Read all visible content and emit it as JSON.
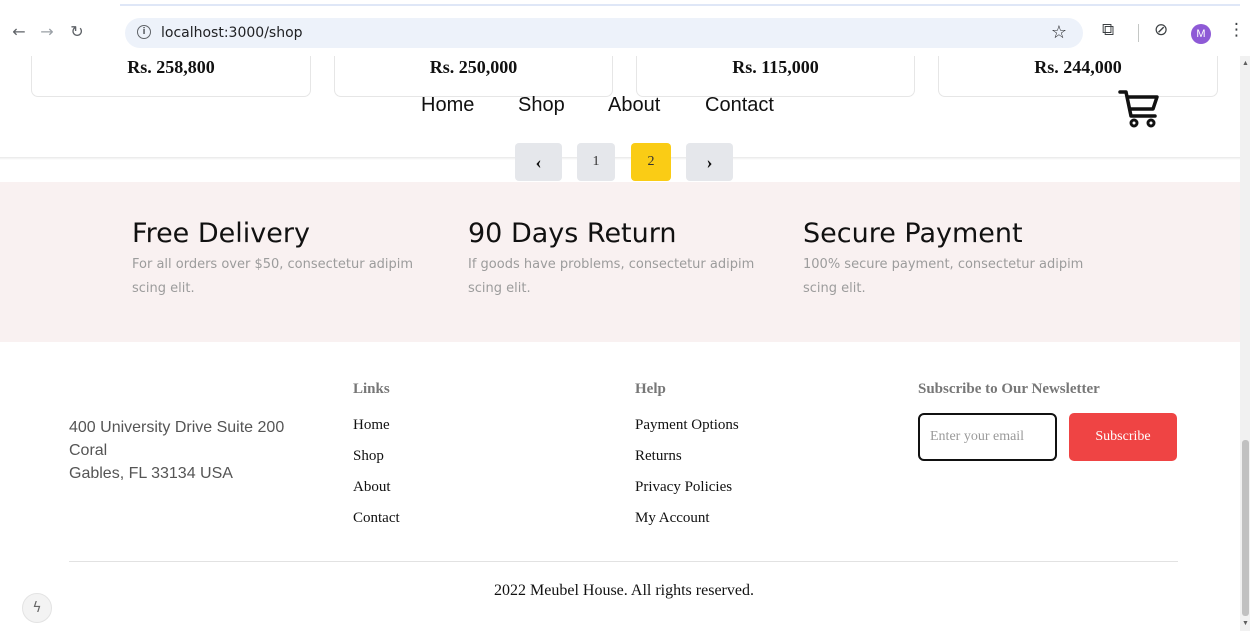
{
  "browser": {
    "url": "localhost:3000/shop",
    "avatar_initial": "M"
  },
  "product_prices": [
    "Rs. 258,800",
    "Rs. 250,000",
    "Rs. 115,000",
    "Rs. 244,000"
  ],
  "nav": {
    "items": [
      "Home",
      "Shop",
      "About",
      "Contact"
    ],
    "cart_icon": "cart-icon"
  },
  "pagination": {
    "prev": "‹",
    "pages": [
      "1",
      "2"
    ],
    "current": "2",
    "next": "›"
  },
  "features": [
    {
      "title": "Free Delivery",
      "desc": "For all orders over $50, consectetur adipim scing elit."
    },
    {
      "title": "90 Days Return",
      "desc": "If goods have problems, consectetur adipim scing elit."
    },
    {
      "title": "Secure Payment",
      "desc": "100% secure payment, consectetur adipim scing elit."
    }
  ],
  "footer": {
    "address_line1": "400 University Drive Suite 200",
    "address_line2": "Coral",
    "address_line3": "Gables, FL 33134 USA",
    "links_heading": "Links",
    "links": [
      "Home",
      "Shop",
      "About",
      "Contact"
    ],
    "help_heading": "Help",
    "help": [
      "Payment Options",
      "Returns",
      "Privacy Policies",
      "My Account"
    ],
    "newsletter_heading": "Subscribe to Our Newsletter",
    "email_placeholder": "Enter your email",
    "subscribe_label": "Subscribe",
    "copyright": "2022 Meubel House. All rights reserved."
  },
  "colors": {
    "accent_yellow": "#facc15",
    "subscribe_red": "#ef4444",
    "features_bg": "#f9f1f1"
  }
}
